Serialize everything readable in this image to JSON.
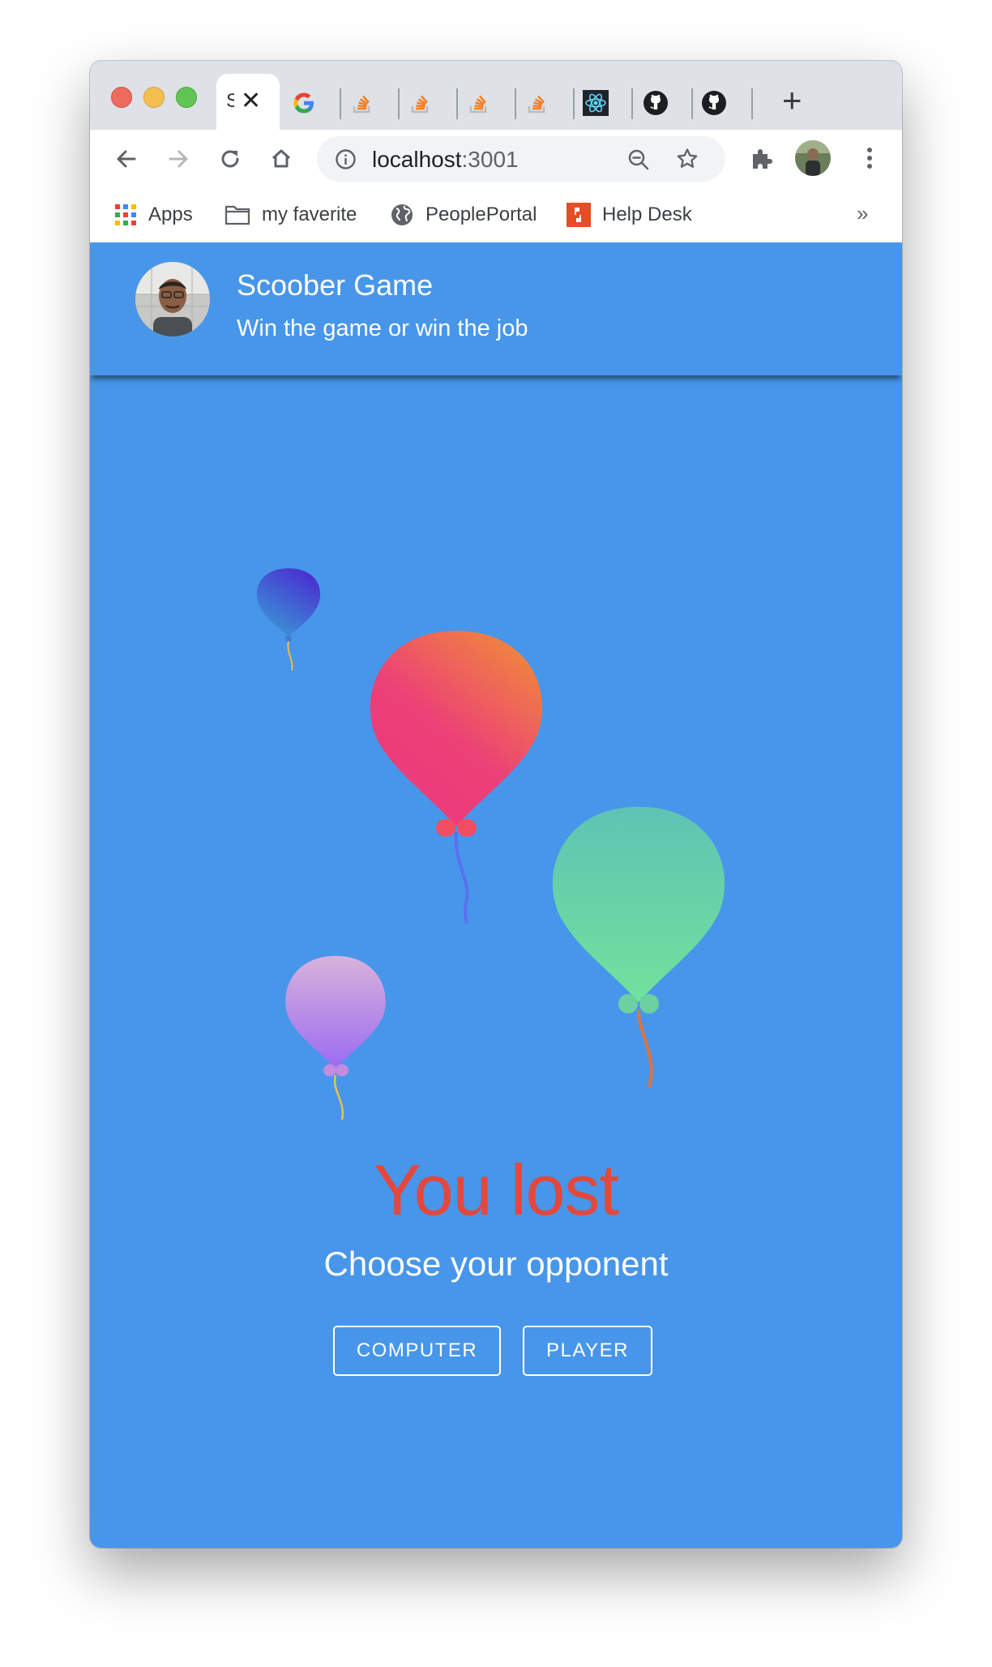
{
  "browser": {
    "active_tab": {
      "title": "S",
      "close_icon": "close-icon"
    },
    "tab_icons": [
      "google-icon",
      "stackoverflow-icon",
      "stackoverflow-icon",
      "stackoverflow-icon",
      "stackoverflow-icon",
      "react-icon",
      "github-icon",
      "github-icon"
    ],
    "new_tab_label": "+",
    "url_host": "localhost",
    "url_port": ":3001",
    "bookmarks": [
      {
        "label": "Apps",
        "icon": "apps-grid-icon"
      },
      {
        "label": "my faverite",
        "icon": "folder-icon"
      },
      {
        "label": "PeoplePortal",
        "icon": "globe-icon"
      },
      {
        "label": "Help Desk",
        "icon": "helpdesk-icon"
      }
    ],
    "more_bookmarks": "»"
  },
  "app": {
    "title": "Scoober Game",
    "subtitle": "Win the game or win the job",
    "result_text": "You lost",
    "prompt": "Choose your opponent",
    "buttons": {
      "computer": "COMPUTER",
      "player": "PLAYER"
    }
  },
  "colors": {
    "background": "#4796ea",
    "result_text": "#e4473b",
    "text": "#ffffff"
  }
}
